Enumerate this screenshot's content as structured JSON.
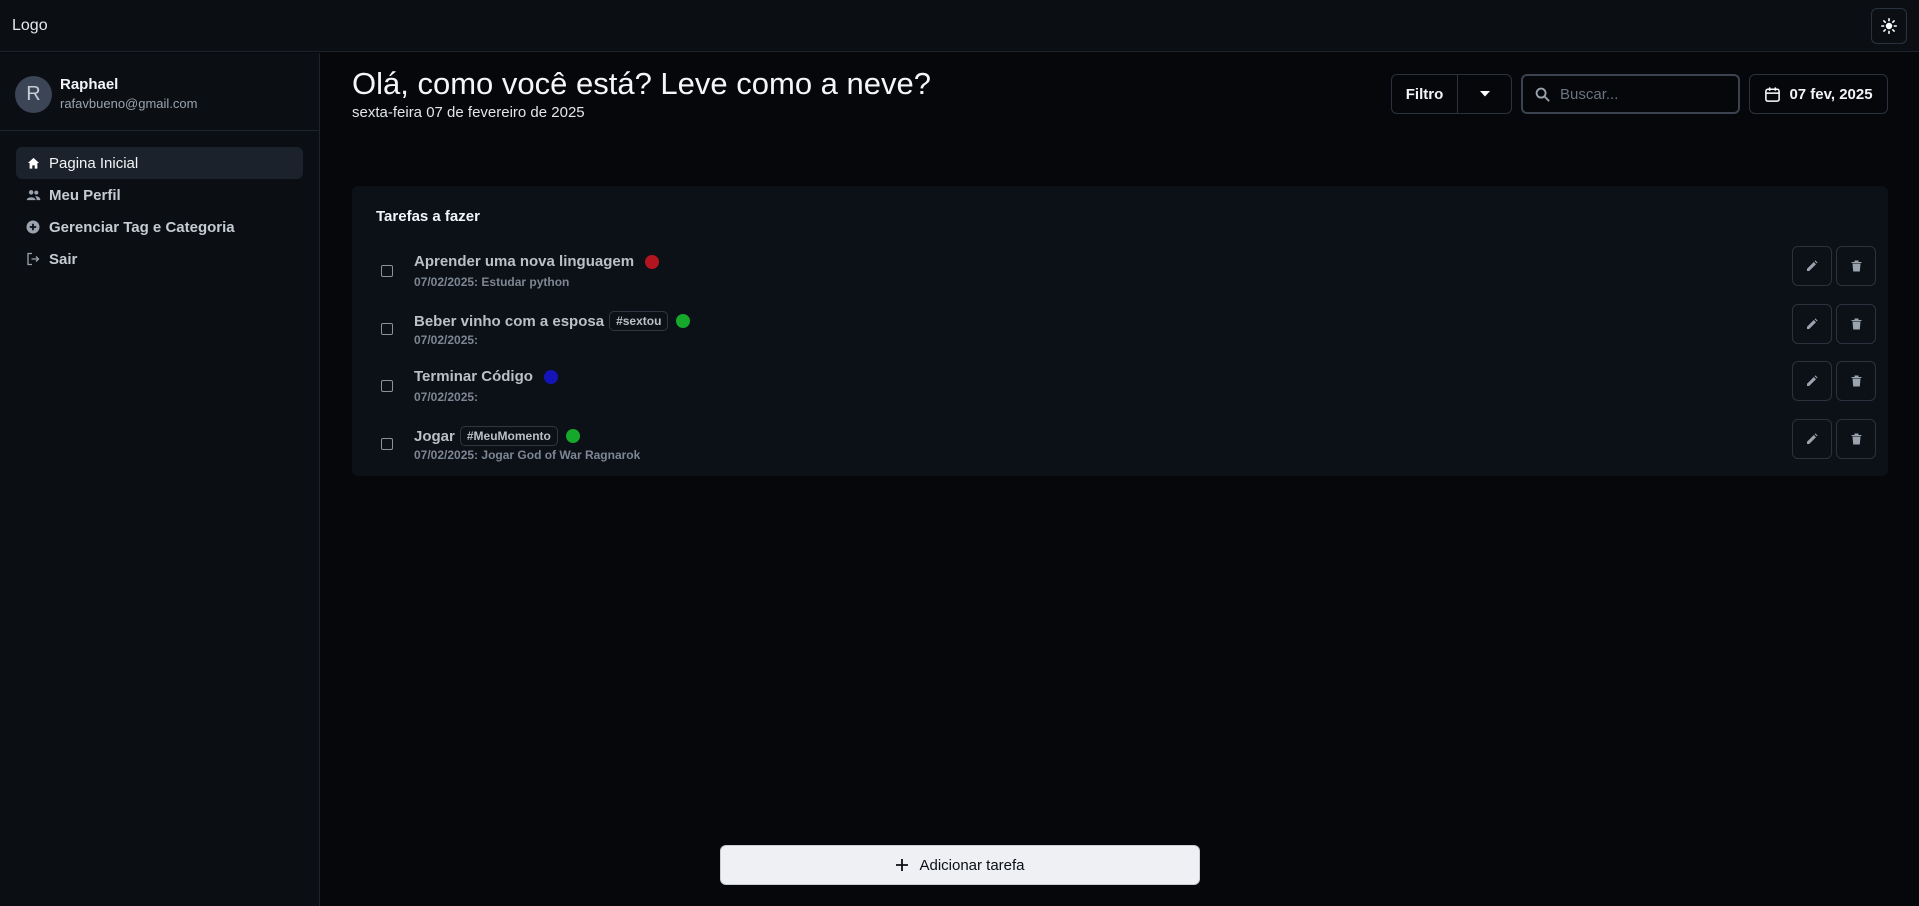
{
  "topbar": {
    "logo": "Logo",
    "theme_icon": "sun-icon"
  },
  "profile": {
    "initial": "R",
    "name": "Raphael",
    "email": "rafavbueno@gmail.com"
  },
  "nav": [
    {
      "label": "Pagina Inicial",
      "icon": "home-icon",
      "active": true
    },
    {
      "label": "Meu Perfil",
      "icon": "users-icon",
      "active": false
    },
    {
      "label": "Gerenciar Tag e Categoria",
      "icon": "plus-circle-icon",
      "active": false
    },
    {
      "label": "Sair",
      "icon": "logout-icon",
      "active": false
    }
  ],
  "header": {
    "greeting": "Olá, como você está? Leve como a neve?",
    "date": "sexta-feira 07 de fevereiro de 2025",
    "filter_label": "Filtro",
    "search_placeholder": "Buscar...",
    "date_button": "07 fev, 2025"
  },
  "tasks_panel": {
    "title": "Tarefas a fazer",
    "tasks": [
      {
        "title": "Aprender uma nova linguagem",
        "tag": "",
        "color": "#b3151f",
        "subtitle": "07/02/2025: Estudar python"
      },
      {
        "title": "Beber vinho com a esposa",
        "tag": "#sextou",
        "color": "#16a82a",
        "subtitle": "07/02/2025:"
      },
      {
        "title": "Terminar Código",
        "tag": "",
        "color": "#1414b8",
        "subtitle": "07/02/2025:"
      },
      {
        "title": "Jogar",
        "tag": "#MeuMomento",
        "color": "#16a82a",
        "subtitle": "07/02/2025: Jogar God of War Ragnarok"
      }
    ]
  },
  "add_button": {
    "label": "Adicionar tarefa"
  }
}
